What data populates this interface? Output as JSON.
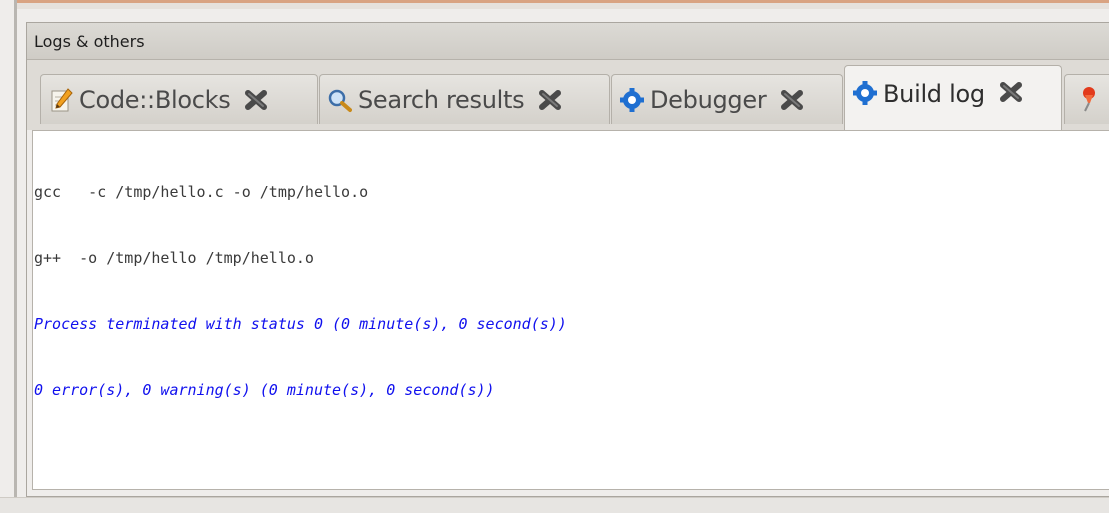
{
  "panel": {
    "title": "Logs & others"
  },
  "tabs": [
    {
      "label": "Code::Blocks",
      "icon": "note-pencil-icon",
      "active": false
    },
    {
      "label": "Search results",
      "icon": "magnifier-icon",
      "active": false
    },
    {
      "label": "Debugger",
      "icon": "gear-icon",
      "active": false
    },
    {
      "label": "Build log",
      "icon": "gear-icon",
      "active": true
    },
    {
      "label": "",
      "icon": "pushpin-icon",
      "active": false
    }
  ],
  "build_log": {
    "lines": [
      {
        "text": "gcc   -c /tmp/hello.c -o /tmp/hello.o",
        "style": "plain"
      },
      {
        "text": "g++  -o /tmp/hello /tmp/hello.o",
        "style": "plain"
      },
      {
        "text": "Process terminated with status 0 (0 minute(s), 0 second(s))",
        "style": "status"
      },
      {
        "text": "0 error(s), 0 warning(s) (0 minute(s), 0 second(s))",
        "style": "status"
      }
    ]
  },
  "colors": {
    "status_text": "#1010ee",
    "plain_text": "#3a3a3a",
    "top_accent": "#d9a382"
  }
}
